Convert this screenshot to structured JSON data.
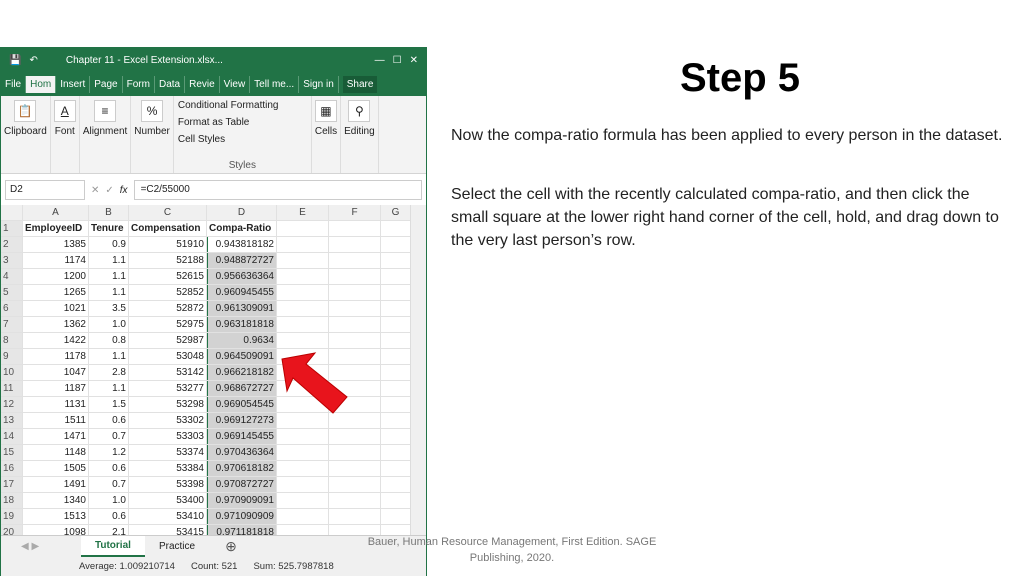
{
  "window": {
    "title": "Chapter 11 - Excel Extension.xlsx...",
    "tabs": [
      "File",
      "Hom",
      "Insert",
      "Page",
      "Form",
      "Data",
      "Revie",
      "View",
      "Tell me...",
      "Sign in",
      "Share"
    ]
  },
  "ribbon": {
    "groups": [
      "Clipboard",
      "Font",
      "Alignment",
      "Number"
    ],
    "styles": [
      "Conditional Formatting",
      "Format as Table",
      "Cell Styles"
    ],
    "styles_label": "Styles",
    "right": [
      "Cells",
      "Editing"
    ]
  },
  "formula": {
    "name_box": "D2",
    "fx": "fx",
    "value": "=C2/55000"
  },
  "columns": [
    "A",
    "B",
    "C",
    "D",
    "E",
    "F",
    "G"
  ],
  "headers": [
    "EmployeeID",
    "Tenure",
    "Compensation",
    "Compa-Ratio"
  ],
  "rows": [
    [
      "1385",
      "0.9",
      "51910",
      "0.943818182"
    ],
    [
      "1174",
      "1.1",
      "52188",
      "0.948872727"
    ],
    [
      "1200",
      "1.1",
      "52615",
      "0.956636364"
    ],
    [
      "1265",
      "1.1",
      "52852",
      "0.960945455"
    ],
    [
      "1021",
      "3.5",
      "52872",
      "0.961309091"
    ],
    [
      "1362",
      "1.0",
      "52975",
      "0.963181818"
    ],
    [
      "1422",
      "0.8",
      "52987",
      "0.9634"
    ],
    [
      "1178",
      "1.1",
      "53048",
      "0.964509091"
    ],
    [
      "1047",
      "2.8",
      "53142",
      "0.966218182"
    ],
    [
      "1187",
      "1.1",
      "53277",
      "0.968672727"
    ],
    [
      "1131",
      "1.5",
      "53298",
      "0.969054545"
    ],
    [
      "1511",
      "0.6",
      "53302",
      "0.969127273"
    ],
    [
      "1471",
      "0.7",
      "53303",
      "0.969145455"
    ],
    [
      "1148",
      "1.2",
      "53374",
      "0.970436364"
    ],
    [
      "1505",
      "0.6",
      "53384",
      "0.970618182"
    ],
    [
      "1491",
      "0.7",
      "53398",
      "0.970872727"
    ],
    [
      "1340",
      "1.0",
      "53400",
      "0.970909091"
    ],
    [
      "1513",
      "0.6",
      "53410",
      "0.971090909"
    ],
    [
      "1098",
      "2.1",
      "53415",
      "0.971181818"
    ]
  ],
  "sheets": [
    "Tutorial",
    "Practice"
  ],
  "status": {
    "average": "Average: 1.009210714",
    "count": "Count: 521",
    "sum": "Sum: 525.7987818"
  },
  "slide": {
    "title": "Step 5",
    "p1": "Now the compa-ratio formula has been applied to every person in the dataset.",
    "p2": "Select the cell with the recently calculated compa-ratio, and then click the small square at the lower right hand corner of the cell, hold, and drag down to the very last person’s row.",
    "footer": "Bauer, Human Resource Management, First Edition. SAGE Publishing, 2020."
  },
  "colors": {
    "excel_green": "#217346",
    "arrow": "#e8141c"
  }
}
